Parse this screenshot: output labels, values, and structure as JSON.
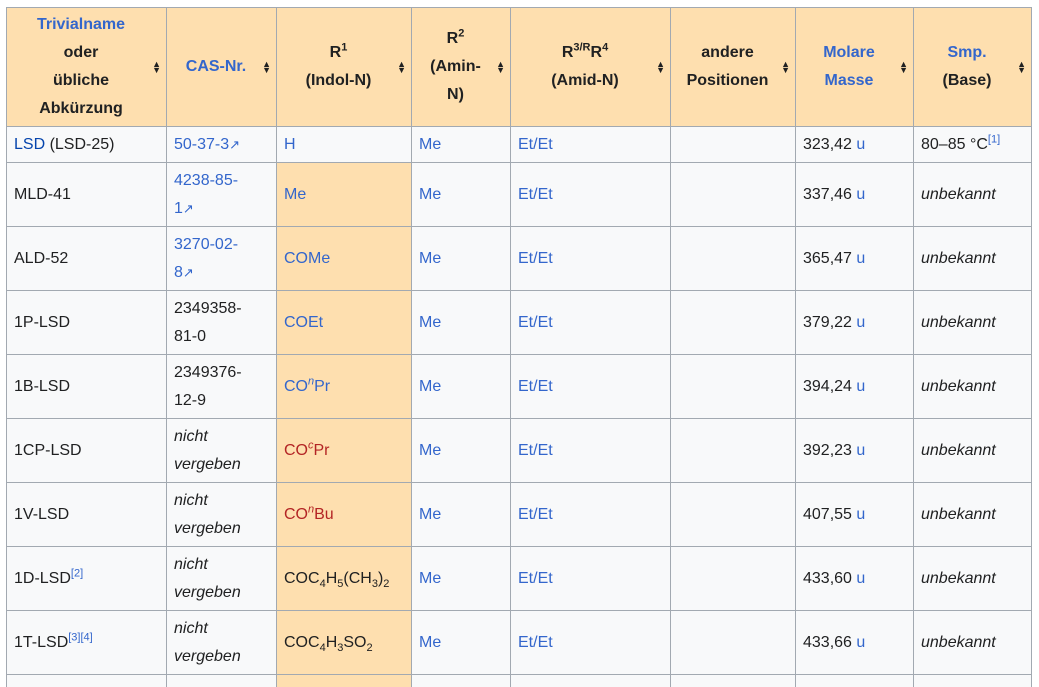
{
  "headers": [
    {
      "label": "Trivialname oder übliche Abkürzung",
      "link": true
    },
    {
      "label": "CAS-Nr.",
      "link": true
    },
    {
      "label": "R",
      "sup": "1",
      "sub_label": "(Indol-N)"
    },
    {
      "label": "R",
      "sup": "2",
      "sub_label": "(Amin-N)"
    },
    {
      "label": "R",
      "sup": "3/R",
      "sup2": "4",
      "sub_label": "(Amid-N)"
    },
    {
      "label": "andere Positionen"
    },
    {
      "label": "Molare Masse",
      "link": true
    },
    {
      "label": "Smp.",
      "sub_label": "(Base)",
      "link": true
    }
  ],
  "rows": [
    {
      "name": "LSD",
      "name_extra": " (LSD-25)",
      "cas": "50-37-3",
      "r1": "H",
      "r2": "Me",
      "r34": "Et/Et",
      "mass": "323,42",
      "unit": "u",
      "mp": "80–85 °C",
      "mp_ref": "[1]"
    },
    {
      "name": "MLD-41",
      "cas": "4238-85-1",
      "r1": "Me",
      "r2": "Me",
      "r34": "Et/Et",
      "mass": "337,46",
      "unit": "u",
      "mp": "unbekannt"
    },
    {
      "name": "ALD-52",
      "cas": "3270-02-8",
      "r1": "COMe",
      "r2": "Me",
      "r34": "Et/Et",
      "mass": "365,47",
      "unit": "u",
      "mp": "unbekannt"
    },
    {
      "name": "1P-LSD",
      "cas": "2349358-81-0",
      "r1": "COEt",
      "r2": "Me",
      "r34": "Et/Et",
      "mass": "379,22",
      "unit": "u",
      "mp": "unbekannt"
    },
    {
      "name": "1B-LSD",
      "cas": "2349376-12-9",
      "r1_a": "CO",
      "r1_sup": "n",
      "r1_b": "Pr",
      "r2": "Me",
      "r34": "Et/Et",
      "mass": "394,24",
      "unit": "u",
      "mp": "unbekannt"
    },
    {
      "name": "1CP-LSD",
      "cas": "nicht vergeben",
      "r1_a": "CO",
      "r1_sup": "c",
      "r1_b": "Pr",
      "r2": "Me",
      "r34": "Et/Et",
      "mass": "392,23",
      "unit": "u",
      "mp": "unbekannt"
    },
    {
      "name": "1V-LSD",
      "cas": "nicht vergeben",
      "r1_a": "CO",
      "r1_sup": "n",
      "r1_b": "Bu",
      "r2": "Me",
      "r34": "Et/Et",
      "mass": "407,55",
      "unit": "u",
      "mp": "unbekannt"
    },
    {
      "name": "1D-LSD",
      "name_ref": "[2]",
      "cas": "nicht vergeben",
      "r1_formula": [
        "COC",
        "4",
        "H",
        "5",
        "(CH",
        "3",
        ")",
        "2"
      ],
      "r2": "Me",
      "r34": "Et/Et",
      "mass": "433,60",
      "unit": "u",
      "mp": "unbekannt"
    },
    {
      "name": "1T-LSD",
      "name_ref": "[3][4]",
      "cas": "nicht vergeben",
      "r1_formula": [
        "COC",
        "4",
        "H",
        "3",
        "SO",
        "2"
      ],
      "r2": "Me",
      "r34": "Et/Et",
      "mass": "433,66",
      "unit": "u",
      "mp": "unbekannt"
    }
  ]
}
